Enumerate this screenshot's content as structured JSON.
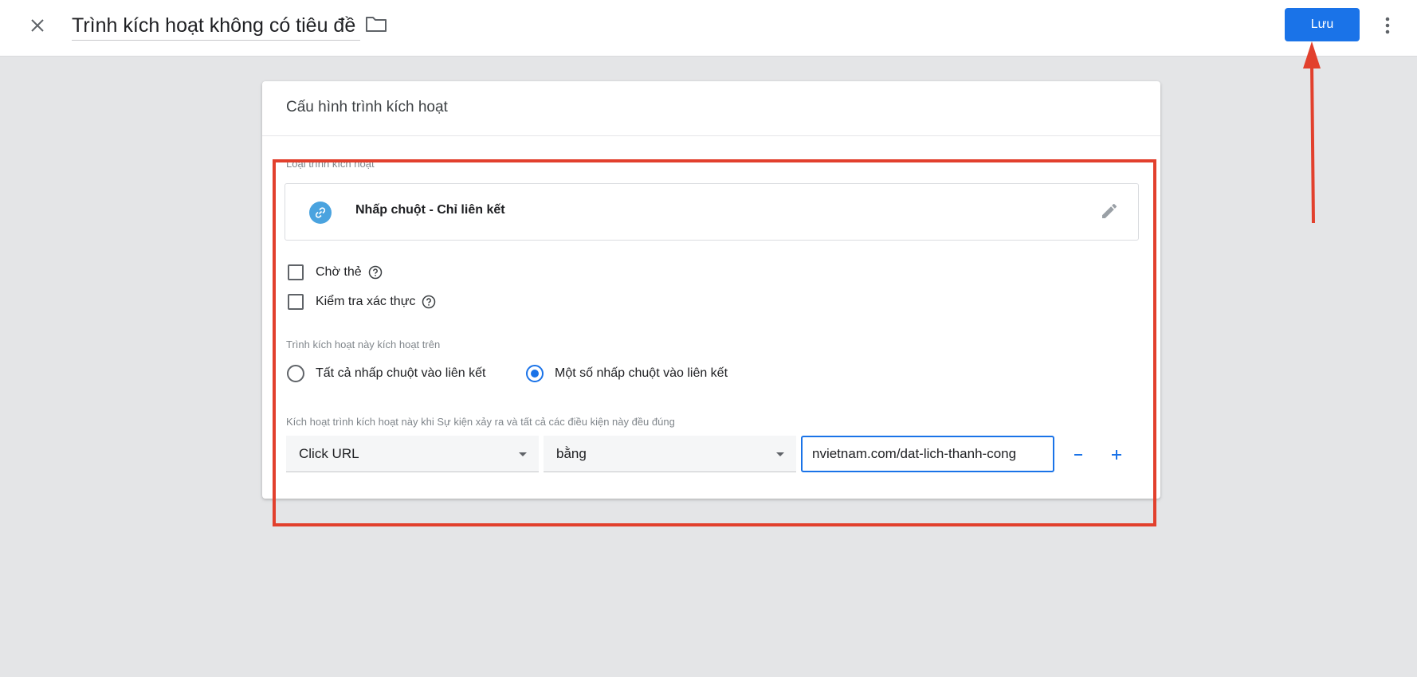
{
  "header": {
    "title": "Trình kích hoạt không có tiêu đề",
    "save_label": "Lưu"
  },
  "card": {
    "title": "Cấu hình trình kích hoạt",
    "type_label": "Loại trình kích hoạt",
    "trigger_type": "Nhấp chuột - Chỉ liên kết",
    "checkboxes": [
      {
        "label": "Chờ thẻ",
        "checked": false
      },
      {
        "label": "Kiểm tra xác thực",
        "checked": false
      }
    ],
    "fires_on_label": "Trình kích hoạt này kích hoạt trên",
    "radios": [
      {
        "label": "Tất cả nhấp chuột vào liên kết",
        "checked": false
      },
      {
        "label": "Một số nhấp chuột vào liên kết",
        "checked": true
      }
    ],
    "condition_label": "Kích hoạt trình kích hoạt này khi Sự kiện xảy ra và tất cả các điều kiện này đều đúng",
    "condition": {
      "variable": "Click URL",
      "operator": "bằng",
      "value": "nvietnam.com/dat-lich-thanh-cong"
    }
  },
  "colors": {
    "accent": "#1a73e8",
    "annotation": "#e2402d"
  },
  "icons": [
    "close-icon",
    "folder-icon",
    "more-vert-icon",
    "link-icon",
    "pencil-icon",
    "help-icon",
    "chevron-down-icon",
    "minus-icon",
    "plus-icon"
  ]
}
